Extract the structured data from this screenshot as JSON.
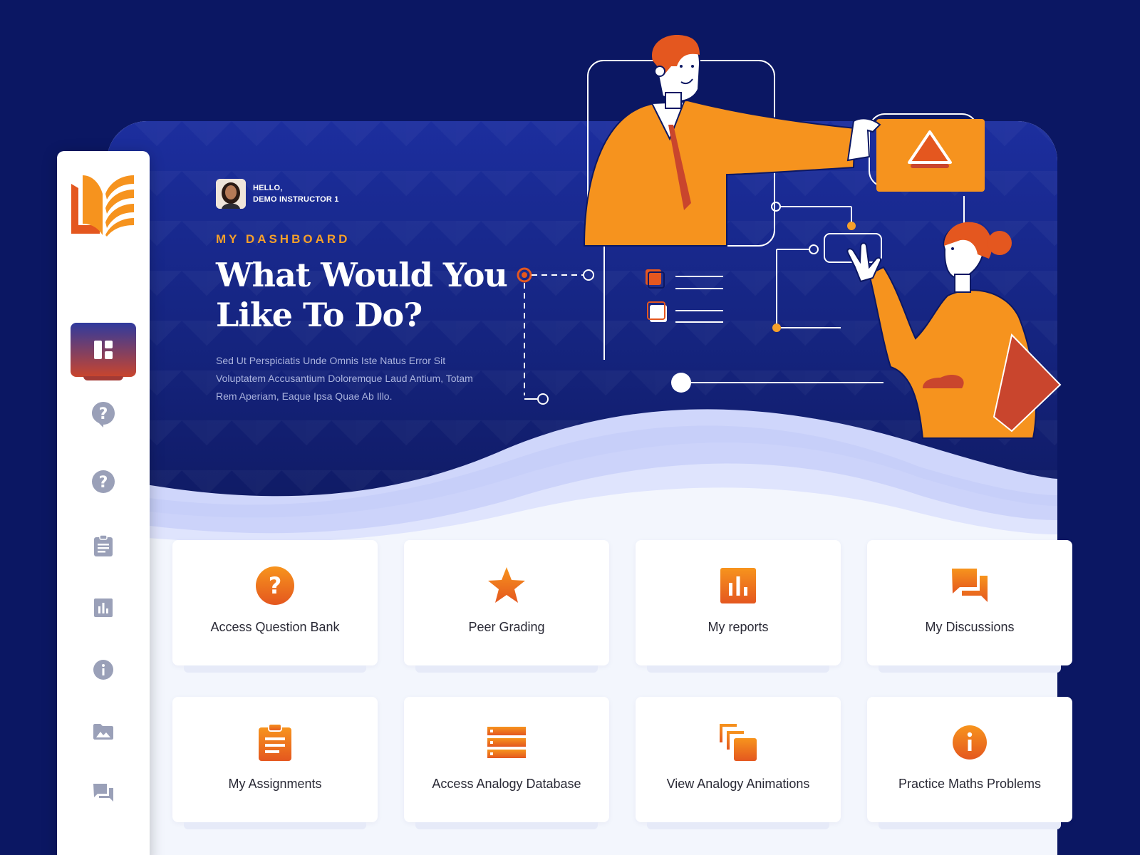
{
  "colors": {
    "background": "#0b1763",
    "accent_orange": "#f6a02a",
    "icon_orange": "#e4571f",
    "sidebar_icon": "#9aa0b8"
  },
  "greeting": {
    "hello": "HELLO,",
    "name": "DEMO INSTRUCTOR 1"
  },
  "hero": {
    "eyebrow": "MY DASHBOARD",
    "headline_line1": "What Would You",
    "headline_line2": "Like To Do?",
    "description": "Sed Ut Perspiciatis Unde Omnis Iste Natus Error Sit Voluptatem Accusantium Doloremque Laud Antium, Totam Rem Aperiam, Eaque Ipsa Quae Ab Illo."
  },
  "sidebar": {
    "items": [
      {
        "icon": "dashboard-icon",
        "active": true
      },
      {
        "icon": "help-chat-icon"
      },
      {
        "icon": "help-circle-icon"
      },
      {
        "icon": "clipboard-icon"
      },
      {
        "icon": "bar-chart-icon"
      },
      {
        "icon": "info-icon"
      },
      {
        "icon": "image-icon"
      },
      {
        "icon": "chat-icon"
      }
    ]
  },
  "cards": [
    {
      "label": "Access Question Bank",
      "icon": "question-icon"
    },
    {
      "label": "Peer Grading",
      "icon": "star-icon"
    },
    {
      "label": "My reports",
      "icon": "bar-chart-icon"
    },
    {
      "label": "My Discussions",
      "icon": "chat-icon"
    },
    {
      "label": "My Assignments",
      "icon": "clipboard-icon"
    },
    {
      "label": "Access Analogy Database",
      "icon": "list-icon"
    },
    {
      "label": "View Analogy Animations",
      "icon": "layers-icon"
    },
    {
      "label": "Practice Maths Problems",
      "icon": "info-icon"
    }
  ]
}
